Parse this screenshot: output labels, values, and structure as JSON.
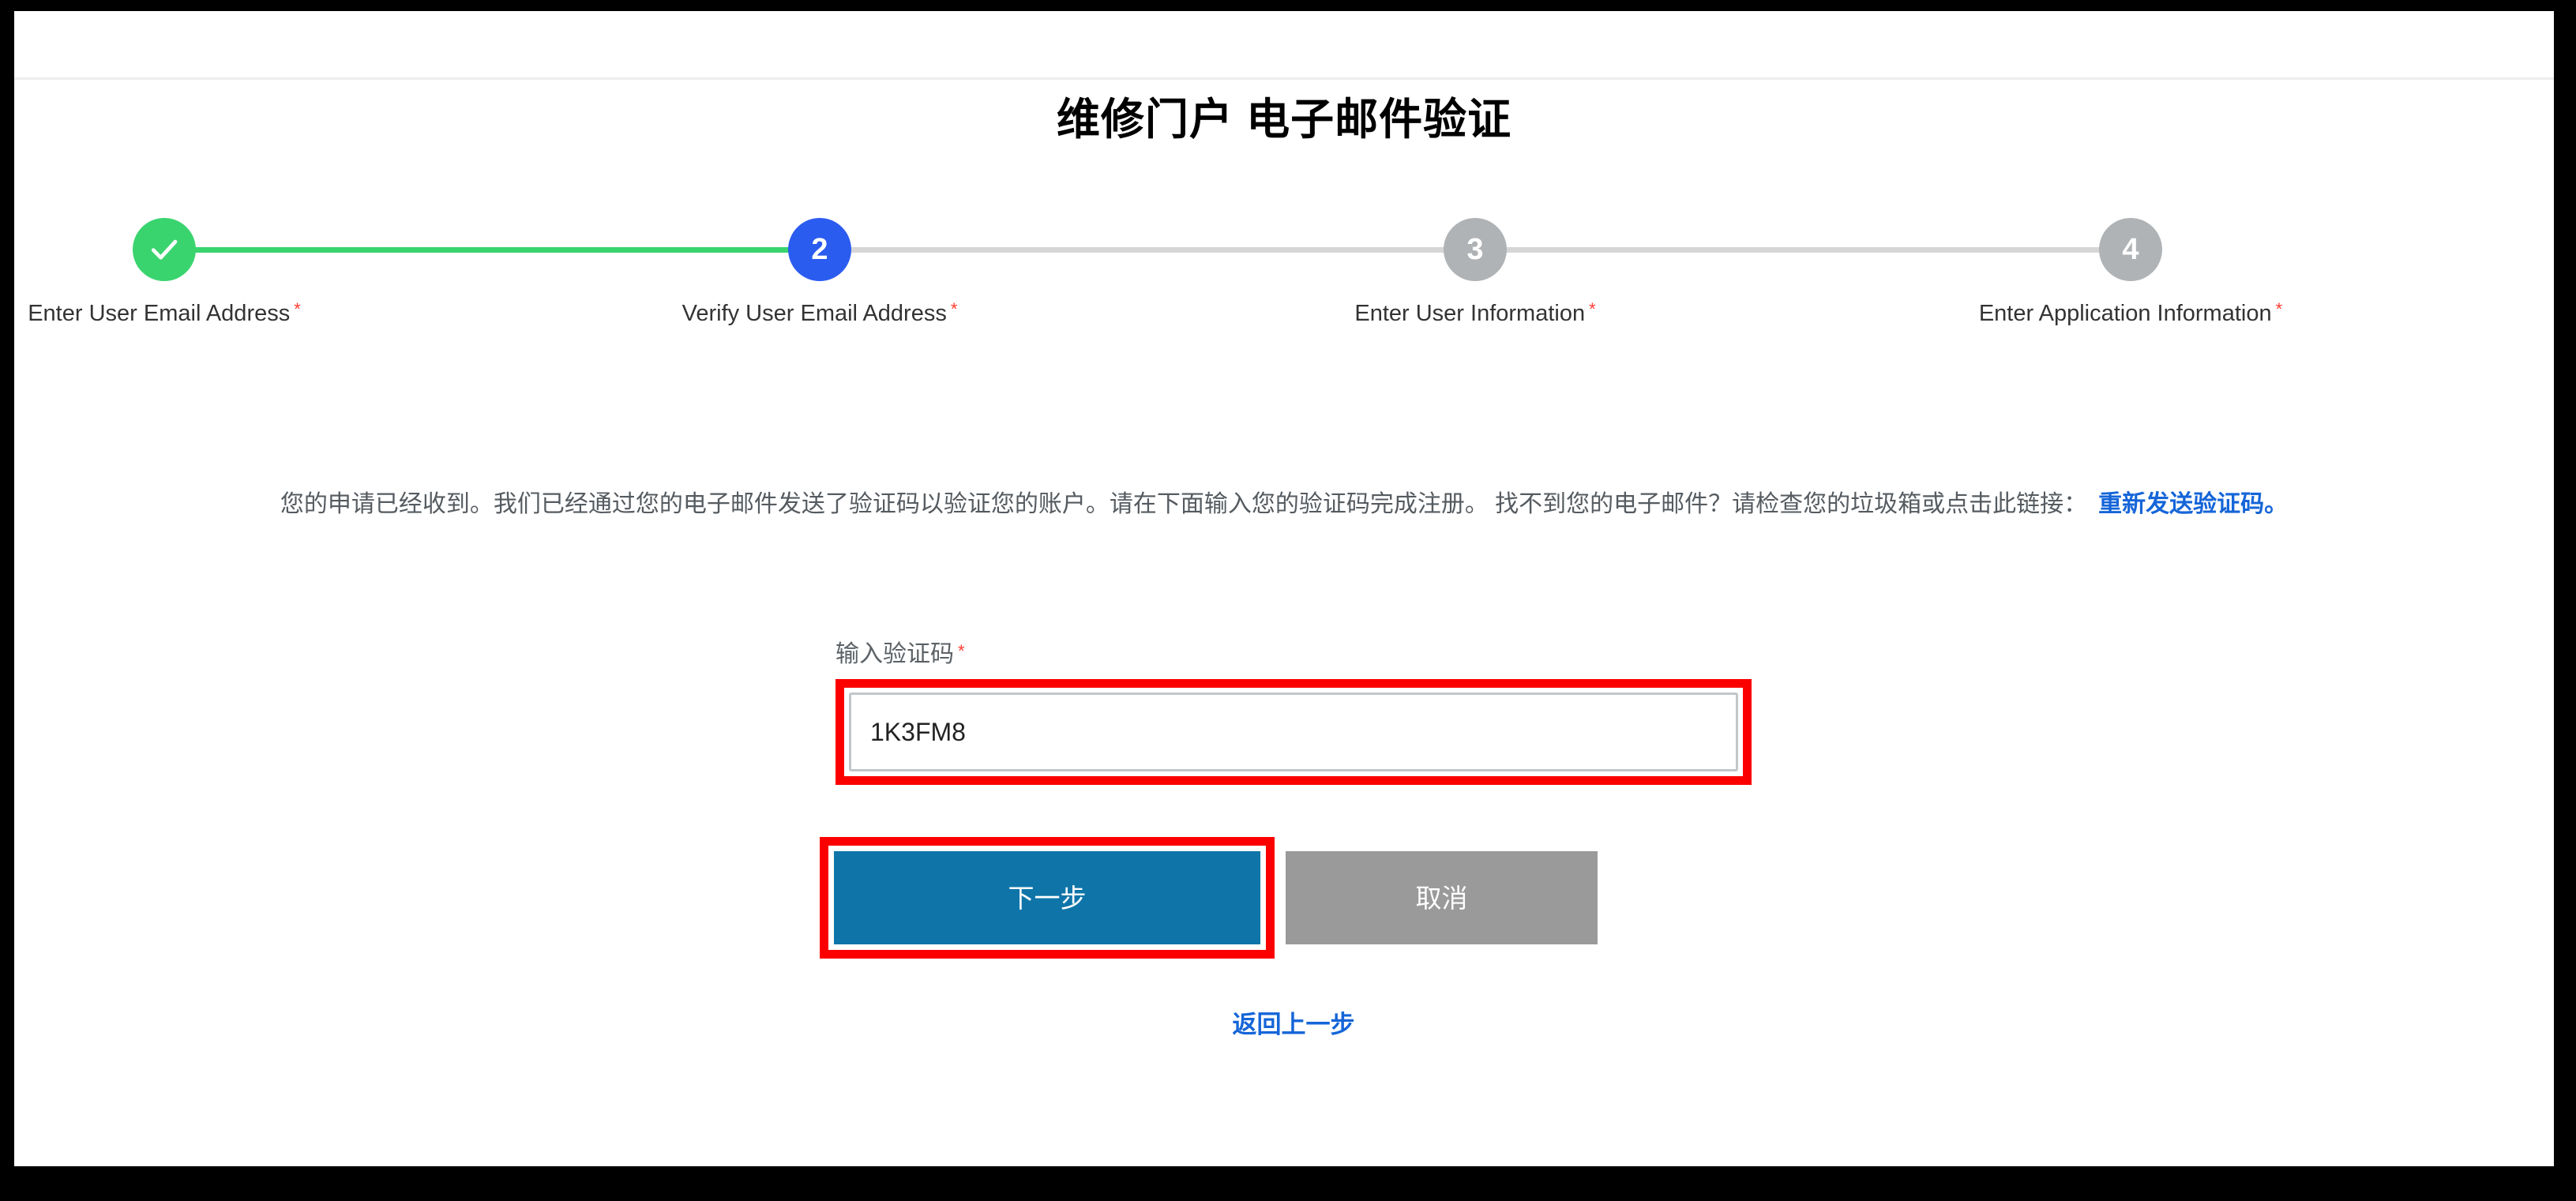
{
  "header": {
    "title": "维修门户 电子邮件验证"
  },
  "stepper": {
    "required_mark": "*",
    "steps": [
      {
        "id": 1,
        "indicator": "check-icon",
        "number": "1",
        "state": "done",
        "label": "Enter User Email Address"
      },
      {
        "id": 2,
        "indicator": "number",
        "number": "2",
        "state": "active",
        "label": "Verify User Email Address"
      },
      {
        "id": 3,
        "indicator": "number",
        "number": "3",
        "state": "todo",
        "label": "Enter User Information"
      },
      {
        "id": 4,
        "indicator": "number",
        "number": "4",
        "state": "todo",
        "label": "Enter Application Information"
      }
    ]
  },
  "intro": {
    "text": "您的申请已经收到。我们已经通过您的电子邮件发送了验证码以验证您的账户。请在下面输入您的验证码完成注册。 找不到您的电子邮件？请检查您的垃圾箱或点击此链接：",
    "resend_link": "重新发送验证码。"
  },
  "form": {
    "code_label": "输入验证码",
    "code_required_mark": "*",
    "code_value": "1K3FM8",
    "code_placeholder": ""
  },
  "actions": {
    "next_label": "下一步",
    "cancel_label": "取消",
    "back_label": "返回上一步"
  },
  "colors": {
    "step_done": "#3ad46f",
    "step_active": "#2b5cf0",
    "step_todo": "#b0b3b5",
    "primary_button": "#0f75a9",
    "cancel_button": "#9a9a9a",
    "link": "#1565d8",
    "required": "#ff3b30",
    "highlight": "#fc0000"
  }
}
